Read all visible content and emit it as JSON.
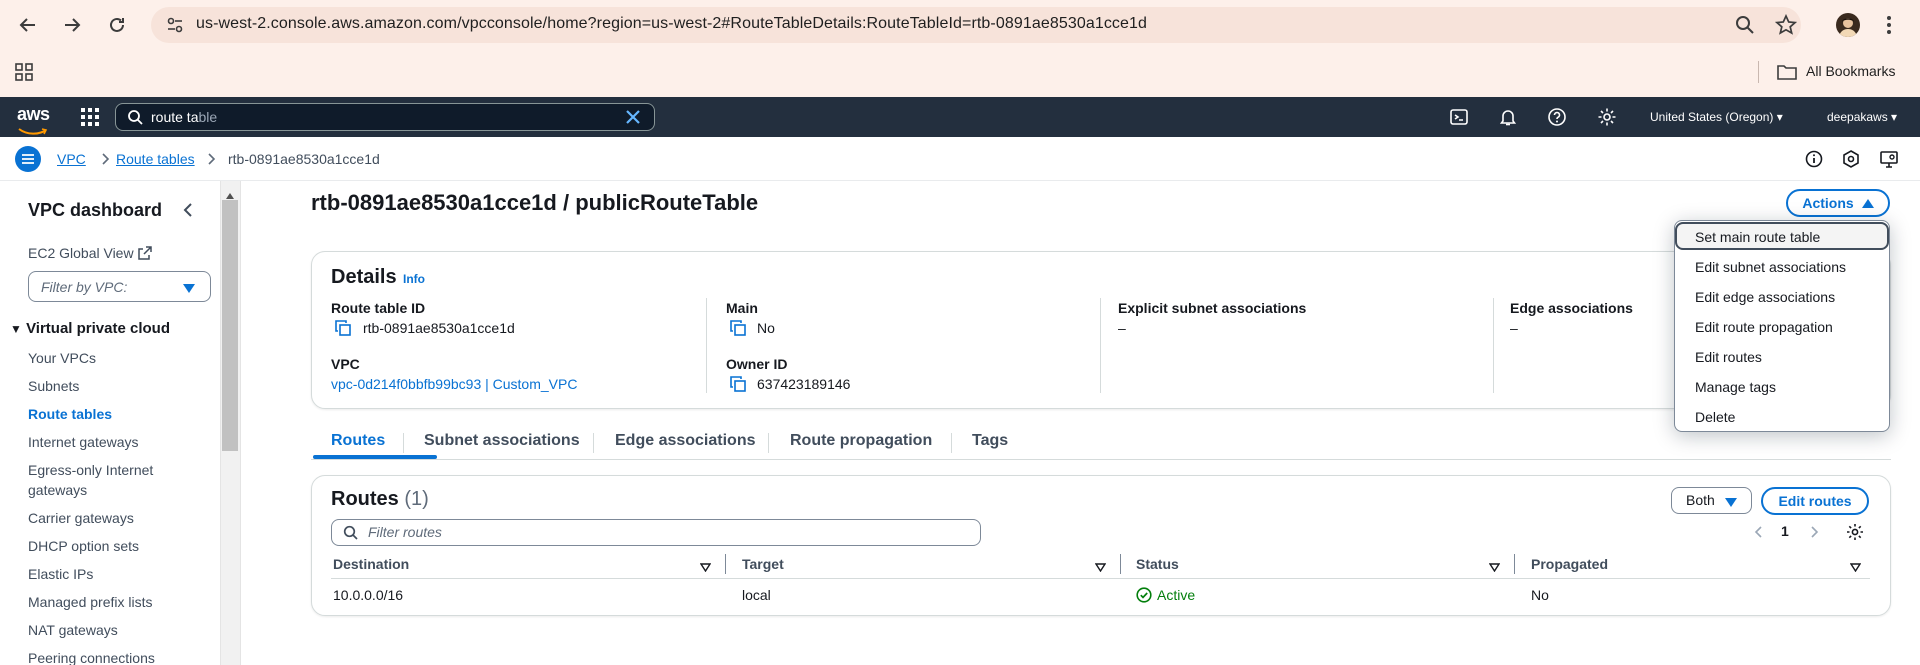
{
  "browser": {
    "url": "us-west-2.console.aws.amazon.com/vpcconsole/home?region=us-west-2#RouteTableDetails:RouteTableId=rtb-0891ae8530a1cce1d",
    "bookmarks_label": "All Bookmarks"
  },
  "aws_nav": {
    "logo": "aws",
    "search_typed": "route ta",
    "search_suggest": "ble",
    "region": "United States (Oregon)",
    "account": "deepakaws"
  },
  "breadcrumb": {
    "items": [
      "VPC",
      "Route tables",
      "rtb-0891ae8530a1cce1d"
    ]
  },
  "sidebar": {
    "title": "VPC dashboard",
    "ec2_global_view": "EC2 Global View",
    "filter_placeholder": "Filter by VPC:",
    "section": "Virtual private cloud",
    "items": [
      {
        "label": "Your VPCs"
      },
      {
        "label": "Subnets"
      },
      {
        "label": "Route tables"
      },
      {
        "label": "Internet gateways"
      },
      {
        "label": "Egress-only Internet"
      },
      {
        "label": "gateways"
      },
      {
        "label": "Carrier gateways"
      },
      {
        "label": "DHCP option sets"
      },
      {
        "label": "Elastic IPs"
      },
      {
        "label": "Managed prefix lists"
      },
      {
        "label": "NAT gateways"
      },
      {
        "label": "Peering connections"
      }
    ]
  },
  "page": {
    "title": "rtb-0891ae8530a1cce1d / publicRouteTable",
    "actions_label": "Actions"
  },
  "details": {
    "title": "Details",
    "info": "Info",
    "route_table_id_label": "Route table ID",
    "route_table_id": "rtb-0891ae8530a1cce1d",
    "main_label": "Main",
    "main_value": "No",
    "explicit_label": "Explicit subnet associations",
    "explicit_value": "–",
    "edge_label": "Edge associations",
    "edge_value": "–",
    "vpc_label": "VPC",
    "vpc_value": "vpc-0d214f0bbfb99bc93 | Custom_VPC",
    "owner_label": "Owner ID",
    "owner_value": "637423189146"
  },
  "tabs": [
    "Routes",
    "Subnet associations",
    "Edge associations",
    "Route propagation",
    "Tags"
  ],
  "routes": {
    "title": "Routes",
    "count": "(1)",
    "view_select": "Both",
    "edit_label": "Edit routes",
    "filter_placeholder": "Filter routes",
    "page_number": "1",
    "columns": [
      "Destination",
      "Target",
      "Status",
      "Propagated"
    ],
    "rows": [
      {
        "destination": "10.0.0.0/16",
        "target": "local",
        "status": "Active",
        "propagated": "No"
      }
    ]
  },
  "actions_menu": {
    "items": [
      "Set main route table",
      "Edit subnet associations",
      "Edit edge associations",
      "Edit route propagation",
      "Edit routes",
      "Manage tags",
      "Delete"
    ]
  },
  "colors": {
    "aws_nav": "#232f3e",
    "link": "#0972d3",
    "success": "#037f0c",
    "chrome_bg": "#fdf0ea"
  }
}
